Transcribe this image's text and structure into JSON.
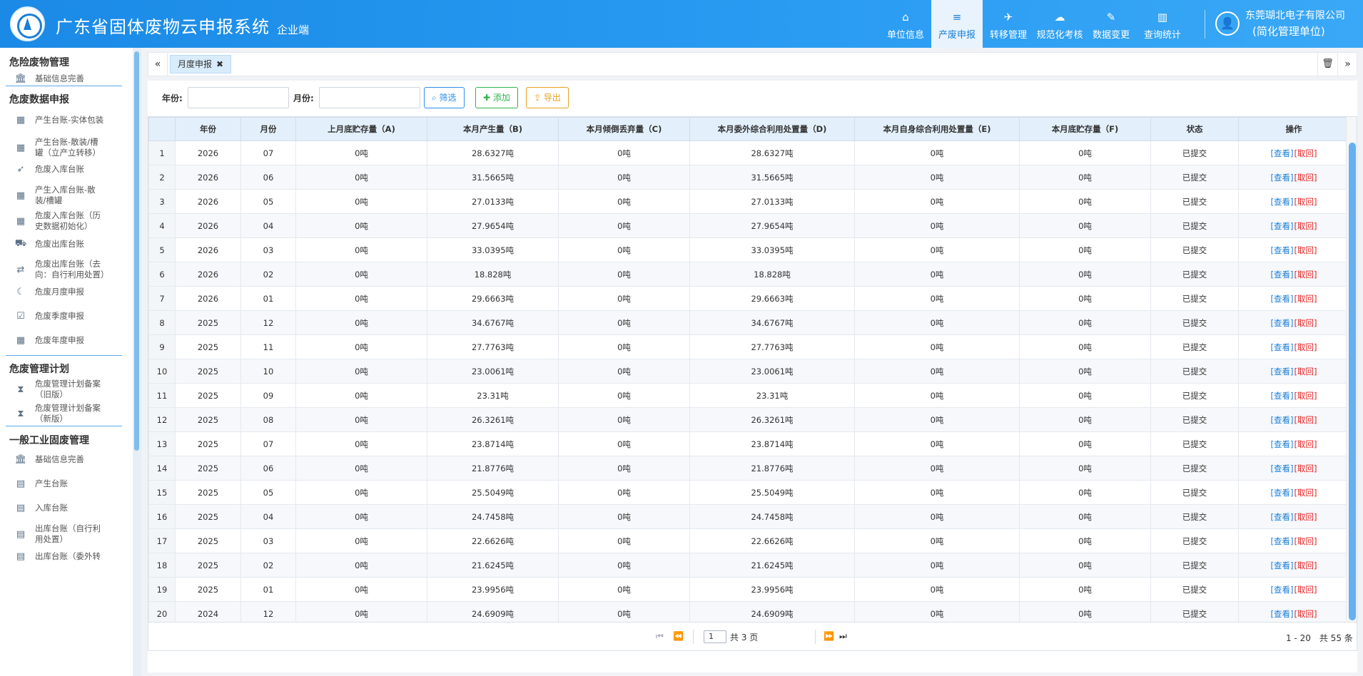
{
  "header": {
    "title": "广东省固体废物云申报系统",
    "subtitle": "企业端",
    "nav": [
      {
        "label": "单位信息",
        "icon": "home-icon",
        "glyph": "⌂",
        "active": false
      },
      {
        "label": "产废申报",
        "icon": "database-icon",
        "glyph": "≡",
        "active": true
      },
      {
        "label": "转移管理",
        "icon": "plane-icon",
        "glyph": "✈",
        "active": false
      },
      {
        "label": "规范化考核",
        "icon": "cloud-upload-icon",
        "glyph": "☁",
        "active": false
      },
      {
        "label": "数据变更",
        "icon": "edit-icon",
        "glyph": "✎",
        "active": false
      },
      {
        "label": "查询统计",
        "icon": "bar-chart-icon",
        "glyph": "▥",
        "active": false
      }
    ],
    "company": "东莞瑚北电子有限公司",
    "role": "(简化管理单位)"
  },
  "sidebar": {
    "sections": [
      {
        "title": "危险废物管理",
        "items": [
          {
            "label": "基础信息完善",
            "icon": "bank-icon",
            "glyph": "🏛"
          }
        ]
      },
      {
        "title": "危废数据申报",
        "items": [
          {
            "label": "产生台账-实体包装",
            "icon": "calendar-icon",
            "glyph": "▦"
          },
          {
            "label": "产生台账-散装/槽罐（立产立转移）",
            "icon": "calendar-icon",
            "glyph": "▦"
          },
          {
            "label": "危废入库台账",
            "icon": "rocket-icon",
            "glyph": "➶"
          },
          {
            "label": "产生入库台账-散装/槽罐",
            "icon": "calendar-icon",
            "glyph": "▦"
          },
          {
            "label": "危废入库台账（历史数据初始化）",
            "icon": "calendar-icon",
            "glyph": "▦"
          },
          {
            "label": "危废出库台账",
            "icon": "truck-icon",
            "glyph": "⛟"
          },
          {
            "label": "危废出库台账（去向：自行利用处置）",
            "icon": "shuffle-icon",
            "glyph": "⇄"
          },
          {
            "label": "危废月度申报",
            "icon": "moon-icon",
            "glyph": "☾"
          },
          {
            "label": "危废季度申报",
            "icon": "calendar-check-icon",
            "glyph": "☑"
          },
          {
            "label": "危废年度申报",
            "icon": "calendar-icon",
            "glyph": "▦"
          }
        ]
      },
      {
        "title": "危废管理计划",
        "items": [
          {
            "label": "危废管理计划备案（旧版）",
            "icon": "hourglass-icon",
            "glyph": "⧗"
          },
          {
            "label": "危废管理计划备案（新版）",
            "icon": "hourglass-icon",
            "glyph": "⧗"
          }
        ]
      },
      {
        "title": "一般工业固废管理",
        "items": [
          {
            "label": "基础信息完善",
            "icon": "bank-icon",
            "glyph": "🏛"
          },
          {
            "label": "产生台账",
            "icon": "book-icon",
            "glyph": "▤"
          },
          {
            "label": "入库台账",
            "icon": "book-icon",
            "glyph": "▤"
          },
          {
            "label": "出库台账（自行利用处置）",
            "icon": "book-icon",
            "glyph": "▤"
          },
          {
            "label": "出库台账（委外转",
            "icon": "book-icon",
            "glyph": "▤"
          }
        ]
      }
    ]
  },
  "tabs": {
    "prev": "«",
    "next": "»",
    "active_label": "月度申报",
    "close_glyph": "✖",
    "trash_glyph": "🗑"
  },
  "filter": {
    "year_label": "年份:",
    "month_label": "月份:",
    "year_value": "",
    "month_value": "",
    "search_btn": "筛选",
    "add_btn": "添加",
    "export_btn": "导出"
  },
  "table": {
    "columns": [
      "年份",
      "月份",
      "上月底贮存量（A)",
      "本月产生量（B)",
      "本月倾倒丢弃量（C)",
      "本月委外综合利用处置量（D)",
      "本月自身综合利用处置量（E)",
      "本月底贮存量（F)",
      "状态",
      "操作"
    ],
    "view_label": "[查看]",
    "back_label": "[取回]",
    "rows": [
      [
        "1",
        "2026",
        "07",
        "0吨",
        "28.6327吨",
        "0吨",
        "28.6327吨",
        "0吨",
        "0吨",
        "已提交"
      ],
      [
        "2",
        "2026",
        "06",
        "0吨",
        "31.5665吨",
        "0吨",
        "31.5665吨",
        "0吨",
        "0吨",
        "已提交"
      ],
      [
        "3",
        "2026",
        "05",
        "0吨",
        "27.0133吨",
        "0吨",
        "27.0133吨",
        "0吨",
        "0吨",
        "已提交"
      ],
      [
        "4",
        "2026",
        "04",
        "0吨",
        "27.9654吨",
        "0吨",
        "27.9654吨",
        "0吨",
        "0吨",
        "已提交"
      ],
      [
        "5",
        "2026",
        "03",
        "0吨",
        "33.0395吨",
        "0吨",
        "33.0395吨",
        "0吨",
        "0吨",
        "已提交"
      ],
      [
        "6",
        "2026",
        "02",
        "0吨",
        "18.828吨",
        "0吨",
        "18.828吨",
        "0吨",
        "0吨",
        "已提交"
      ],
      [
        "7",
        "2026",
        "01",
        "0吨",
        "29.6663吨",
        "0吨",
        "29.6663吨",
        "0吨",
        "0吨",
        "已提交"
      ],
      [
        "8",
        "2025",
        "12",
        "0吨",
        "34.6767吨",
        "0吨",
        "34.6767吨",
        "0吨",
        "0吨",
        "已提交"
      ],
      [
        "9",
        "2025",
        "11",
        "0吨",
        "27.7763吨",
        "0吨",
        "27.7763吨",
        "0吨",
        "0吨",
        "已提交"
      ],
      [
        "10",
        "2025",
        "10",
        "0吨",
        "23.0061吨",
        "0吨",
        "23.0061吨",
        "0吨",
        "0吨",
        "已提交"
      ],
      [
        "11",
        "2025",
        "09",
        "0吨",
        "23.31吨",
        "0吨",
        "23.31吨",
        "0吨",
        "0吨",
        "已提交"
      ],
      [
        "12",
        "2025",
        "08",
        "0吨",
        "26.3261吨",
        "0吨",
        "26.3261吨",
        "0吨",
        "0吨",
        "已提交"
      ],
      [
        "13",
        "2025",
        "07",
        "0吨",
        "23.8714吨",
        "0吨",
        "23.8714吨",
        "0吨",
        "0吨",
        "已提交"
      ],
      [
        "14",
        "2025",
        "06",
        "0吨",
        "21.8776吨",
        "0吨",
        "21.8776吨",
        "0吨",
        "0吨",
        "已提交"
      ],
      [
        "15",
        "2025",
        "05",
        "0吨",
        "25.5049吨",
        "0吨",
        "25.5049吨",
        "0吨",
        "0吨",
        "已提交"
      ],
      [
        "16",
        "2025",
        "04",
        "0吨",
        "24.7458吨",
        "0吨",
        "24.7458吨",
        "0吨",
        "0吨",
        "已提交"
      ],
      [
        "17",
        "2025",
        "03",
        "0吨",
        "22.6626吨",
        "0吨",
        "22.6626吨",
        "0吨",
        "0吨",
        "已提交"
      ],
      [
        "18",
        "2025",
        "02",
        "0吨",
        "21.6245吨",
        "0吨",
        "21.6245吨",
        "0吨",
        "0吨",
        "已提交"
      ],
      [
        "19",
        "2025",
        "01",
        "0吨",
        "23.9956吨",
        "0吨",
        "23.9956吨",
        "0吨",
        "0吨",
        "已提交"
      ],
      [
        "20",
        "2024",
        "12",
        "0吨",
        "24.6909吨",
        "0吨",
        "24.6909吨",
        "0吨",
        "0吨",
        "已提交"
      ]
    ]
  },
  "pager": {
    "current_page": "1",
    "total_pages_text": "共 3 页",
    "range_text": "1 - 20　共 55 条"
  }
}
